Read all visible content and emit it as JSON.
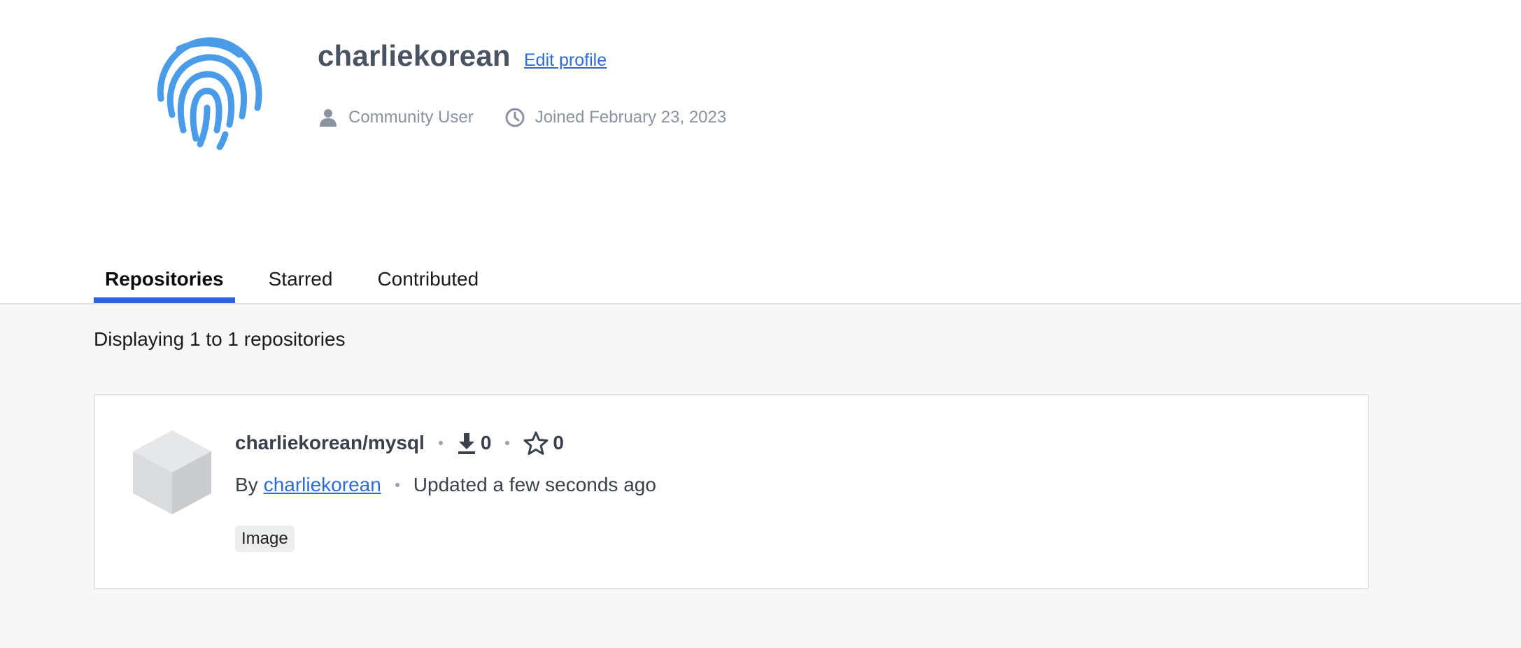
{
  "profile": {
    "username": "charliekorean",
    "edit_profile_label": "Edit profile",
    "role_label": "Community User",
    "joined_label": "Joined February 23, 2023",
    "avatar_icon": "fingerprint-icon",
    "accent_color": "#4a9be8"
  },
  "tabs": [
    {
      "label": "Repositories",
      "active": true
    },
    {
      "label": "Starred",
      "active": false
    },
    {
      "label": "Contributed",
      "active": false
    }
  ],
  "results": {
    "display_count": "Displaying 1 to 1 repositories"
  },
  "repositories": [
    {
      "name": "charliekorean/mysql",
      "pulls": "0",
      "stars": "0",
      "by_prefix": "By",
      "owner": "charliekorean",
      "updated": "Updated a few seconds ago",
      "type_badge": "Image",
      "icon": "cube-icon"
    }
  ],
  "colors": {
    "tab_underline": "#2c66d1",
    "link": "#2e6bd6"
  }
}
